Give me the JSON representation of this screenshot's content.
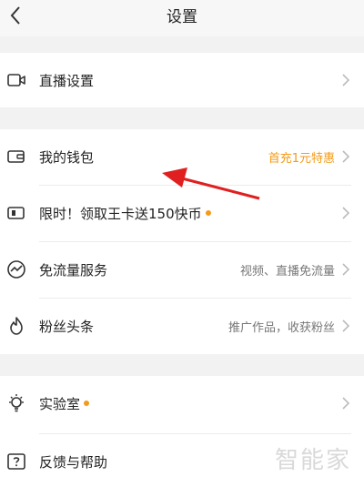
{
  "header": {
    "title": "设置"
  },
  "items": [
    {
      "label": "直播设置",
      "right": ""
    },
    {
      "label": "我的钱包",
      "right": "首充1元特惠"
    },
    {
      "label": "限时！领取王卡送150快币",
      "right": ""
    },
    {
      "label": "免流量服务",
      "right": "视频、直播免流量"
    },
    {
      "label": "粉丝头条",
      "right": "推广作品，收获粉丝"
    },
    {
      "label": "实验室",
      "right": ""
    },
    {
      "label": "反馈与帮助",
      "right": ""
    }
  ],
  "watermark": "智能家",
  "colors": {
    "accent": "#f39b18",
    "arrow": "#e02020"
  }
}
